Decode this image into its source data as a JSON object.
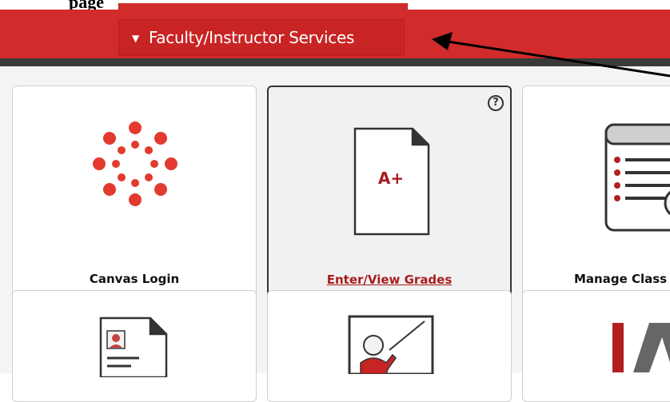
{
  "header": {
    "title_fragment": "page",
    "dropdown_label": "Faculty/Instructor Services"
  },
  "tiles": [
    {
      "label": "Canvas Login",
      "icon": "canvas-logo-icon"
    },
    {
      "label": "Enter/View Grades",
      "icon": "document-grade-icon",
      "grade_text": "A+",
      "help": "?"
    },
    {
      "label": "Manage Class",
      "icon": "class-list-icon"
    },
    {
      "label": "",
      "icon": "profile-document-icon"
    },
    {
      "label": "",
      "icon": "teacher-board-icon"
    },
    {
      "label": "",
      "icon": "letter-logo-icon"
    }
  ],
  "colors": {
    "brand_red": "#d22b2b",
    "dark_bar": "#3a3a3a",
    "link_red": "#a91d1d"
  }
}
